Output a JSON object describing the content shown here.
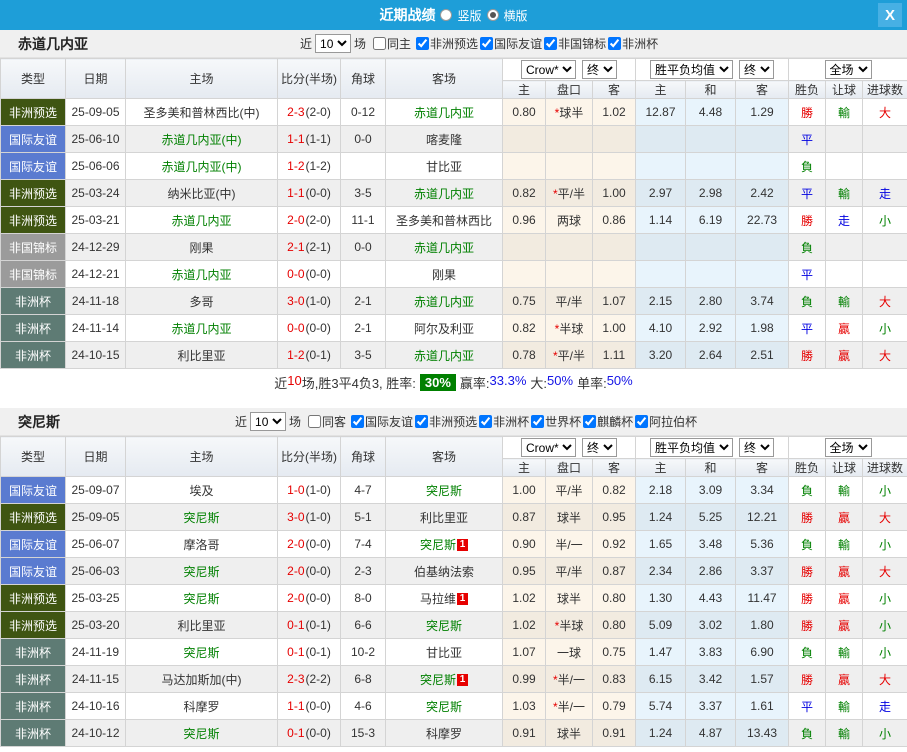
{
  "titlebar": {
    "title": "近期战绩",
    "radio_vertical": "竖版",
    "radio_horizontal": "横版",
    "close_icon": "X"
  },
  "colors": {
    "titlebar_bg": "#1E9ED8",
    "close_btn_bg": "#47B0E4",
    "type_africa_qualifier": "#3F5512",
    "type_intl_friendly": "#5A7BD0",
    "type_african_nations_champ": "#9B9B9B",
    "type_africa_cup": "#5E7B74",
    "self_team_green": "#008000",
    "score_red": "#E60000",
    "win_red": "#E60000",
    "draw_blue": "#0000E0",
    "lose_green": "#008000",
    "summary_badge_green": "#008000"
  },
  "columns": {
    "type": "类型",
    "date": "日期",
    "home": "主场",
    "score": "比分(半场)",
    "corner": "角球",
    "away": "客场",
    "odds_home": "主",
    "odds_handicap": "盘口",
    "odds_away": "客",
    "avg_home": "主",
    "avg_draw": "和",
    "avg_away": "客",
    "result": "胜负",
    "handicap_result": "让球",
    "goals": "进球数"
  },
  "dropdowns": {
    "bookmaker": "Crow*",
    "final1": "终",
    "avg": "胜平负均值",
    "final2": "终",
    "scope": "全场"
  },
  "sections": [
    {
      "team": "赤道几内亚",
      "filter": {
        "near_label": "近",
        "count": "10",
        "games_label": "场",
        "same_label": "同主",
        "leagues": [
          "非洲预选",
          "国际友谊",
          "非国锦标",
          "非洲杯"
        ]
      },
      "rows": [
        {
          "type": "非洲预选",
          "date": "25-09-05",
          "home": "圣多美和普林西比(中)",
          "home_self": false,
          "score": "2-3",
          "half": "(2-0)",
          "corner": "0-12",
          "away": "赤道几内亚",
          "away_self": true,
          "badge": "",
          "odds_home": "0.80",
          "handicap": "*球半",
          "odds_away": "1.02",
          "avg_home": "12.87",
          "avg_draw": "4.48",
          "avg_away": "1.29",
          "result": "勝",
          "handicap_result": "輸",
          "goal_result": "大"
        },
        {
          "type": "国际友谊",
          "date": "25-06-10",
          "home": "赤道几内亚(中)",
          "home_self": true,
          "score": "1-1",
          "half": "(1-1)",
          "corner": "0-0",
          "away": "喀麦隆",
          "away_self": false,
          "badge": "",
          "odds_home": "",
          "handicap": "",
          "odds_away": "",
          "avg_home": "",
          "avg_draw": "",
          "avg_away": "",
          "result": "平",
          "handicap_result": "",
          "goal_result": ""
        },
        {
          "type": "国际友谊",
          "date": "25-06-06",
          "home": "赤道几内亚(中)",
          "home_self": true,
          "score": "1-2",
          "half": "(1-2)",
          "corner": "",
          "away": "甘比亚",
          "away_self": false,
          "badge": "",
          "odds_home": "",
          "handicap": "",
          "odds_away": "",
          "avg_home": "",
          "avg_draw": "",
          "avg_away": "",
          "result": "負",
          "handicap_result": "",
          "goal_result": ""
        },
        {
          "type": "非洲预选",
          "date": "25-03-24",
          "home": "纳米比亚(中)",
          "home_self": false,
          "score": "1-1",
          "half": "(0-0)",
          "corner": "3-5",
          "away": "赤道几内亚",
          "away_self": true,
          "badge": "",
          "odds_home": "0.82",
          "handicap": "*平/半",
          "odds_away": "1.00",
          "avg_home": "2.97",
          "avg_draw": "2.98",
          "avg_away": "2.42",
          "result": "平",
          "handicap_result": "輸",
          "goal_result": "走"
        },
        {
          "type": "非洲预选",
          "date": "25-03-21",
          "home": "赤道几内亚",
          "home_self": true,
          "score": "2-0",
          "half": "(2-0)",
          "corner": "11-1",
          "away": "圣多美和普林西比",
          "away_self": false,
          "badge": "",
          "odds_home": "0.96",
          "handicap": "两球",
          "odds_away": "0.86",
          "avg_home": "1.14",
          "avg_draw": "6.19",
          "avg_away": "22.73",
          "result": "勝",
          "handicap_result": "走",
          "goal_result": "小"
        },
        {
          "type": "非国锦标",
          "date": "24-12-29",
          "home": "刚果",
          "home_self": false,
          "score": "2-1",
          "half": "(2-1)",
          "corner": "0-0",
          "away": "赤道几内亚",
          "away_self": true,
          "badge": "",
          "odds_home": "",
          "handicap": "",
          "odds_away": "",
          "avg_home": "",
          "avg_draw": "",
          "avg_away": "",
          "result": "負",
          "handicap_result": "",
          "goal_result": ""
        },
        {
          "type": "非国锦标",
          "date": "24-12-21",
          "home": "赤道几内亚",
          "home_self": true,
          "score": "0-0",
          "half": "(0-0)",
          "corner": "",
          "away": "刚果",
          "away_self": false,
          "badge": "",
          "odds_home": "",
          "handicap": "",
          "odds_away": "",
          "avg_home": "",
          "avg_draw": "",
          "avg_away": "",
          "result": "平",
          "handicap_result": "",
          "goal_result": ""
        },
        {
          "type": "非洲杯",
          "date": "24-11-18",
          "home": "多哥",
          "home_self": false,
          "score": "3-0",
          "half": "(1-0)",
          "corner": "2-1",
          "away": "赤道几内亚",
          "away_self": true,
          "badge": "",
          "odds_home": "0.75",
          "handicap": "平/半",
          "odds_away": "1.07",
          "avg_home": "2.15",
          "avg_draw": "2.80",
          "avg_away": "3.74",
          "result": "負",
          "handicap_result": "輸",
          "goal_result": "大"
        },
        {
          "type": "非洲杯",
          "date": "24-11-14",
          "home": "赤道几内亚",
          "home_self": true,
          "score": "0-0",
          "half": "(0-0)",
          "corner": "2-1",
          "away": "阿尔及利亚",
          "away_self": false,
          "badge": "",
          "odds_home": "0.82",
          "handicap": "*半球",
          "odds_away": "1.00",
          "avg_home": "4.10",
          "avg_draw": "2.92",
          "avg_away": "1.98",
          "result": "平",
          "handicap_result": "贏",
          "goal_result": "小"
        },
        {
          "type": "非洲杯",
          "date": "24-10-15",
          "home": "利比里亚",
          "home_self": false,
          "score": "1-2",
          "half": "(0-1)",
          "corner": "3-5",
          "away": "赤道几内亚",
          "away_self": true,
          "badge": "",
          "odds_home": "0.78",
          "handicap": "*平/半",
          "odds_away": "1.11",
          "avg_home": "3.20",
          "avg_draw": "2.64",
          "avg_away": "2.51",
          "result": "勝",
          "handicap_result": "贏",
          "goal_result": "大"
        }
      ],
      "summary": {
        "prefix": "近",
        "count": "10",
        "middle": "场,胜3平4负3, 胜率:",
        "win_rate": "30%",
        "stats": [
          {
            "label": "赢率:",
            "value": "33.3%"
          },
          {
            "label": "大:",
            "value": "50%"
          },
          {
            "label": "单率:",
            "value": "50%"
          }
        ]
      }
    },
    {
      "team": "突尼斯",
      "filter": {
        "near_label": "近",
        "count": "10",
        "games_label": "场",
        "same_label": "同客",
        "leagues": [
          "国际友谊",
          "非洲预选",
          "非洲杯",
          "世界杯",
          "麒麟杯",
          "阿拉伯杯"
        ]
      },
      "rows": [
        {
          "type": "国际友谊",
          "date": "25-09-07",
          "home": "埃及",
          "home_self": false,
          "score": "1-0",
          "half": "(1-0)",
          "corner": "4-7",
          "away": "突尼斯",
          "away_self": true,
          "badge": "",
          "odds_home": "1.00",
          "handicap": "平/半",
          "odds_away": "0.82",
          "avg_home": "2.18",
          "avg_draw": "3.09",
          "avg_away": "3.34",
          "result": "負",
          "handicap_result": "輸",
          "goal_result": "小"
        },
        {
          "type": "非洲预选",
          "date": "25-09-05",
          "home": "突尼斯",
          "home_self": true,
          "score": "3-0",
          "half": "(1-0)",
          "corner": "5-1",
          "away": "利比里亚",
          "away_self": false,
          "badge": "",
          "odds_home": "0.87",
          "handicap": "球半",
          "odds_away": "0.95",
          "avg_home": "1.24",
          "avg_draw": "5.25",
          "avg_away": "12.21",
          "result": "勝",
          "handicap_result": "贏",
          "goal_result": "大"
        },
        {
          "type": "国际友谊",
          "date": "25-06-07",
          "home": "摩洛哥",
          "home_self": false,
          "score": "2-0",
          "half": "(0-0)",
          "corner": "7-4",
          "away": "突尼斯",
          "away_self": true,
          "badge": "1",
          "odds_home": "0.90",
          "handicap": "半/一",
          "odds_away": "0.92",
          "avg_home": "1.65",
          "avg_draw": "3.48",
          "avg_away": "5.36",
          "result": "負",
          "handicap_result": "輸",
          "goal_result": "小"
        },
        {
          "type": "国际友谊",
          "date": "25-06-03",
          "home": "突尼斯",
          "home_self": true,
          "score": "2-0",
          "half": "(0-0)",
          "corner": "2-3",
          "away": "伯基纳法索",
          "away_self": false,
          "badge": "",
          "odds_home": "0.95",
          "handicap": "平/半",
          "odds_away": "0.87",
          "avg_home": "2.34",
          "avg_draw": "2.86",
          "avg_away": "3.37",
          "result": "勝",
          "handicap_result": "贏",
          "goal_result": "大"
        },
        {
          "type": "非洲预选",
          "date": "25-03-25",
          "home": "突尼斯",
          "home_self": true,
          "score": "2-0",
          "half": "(0-0)",
          "corner": "8-0",
          "away": "马拉维",
          "away_self": false,
          "badge": "1",
          "odds_home": "1.02",
          "handicap": "球半",
          "odds_away": "0.80",
          "avg_home": "1.30",
          "avg_draw": "4.43",
          "avg_away": "11.47",
          "result": "勝",
          "handicap_result": "贏",
          "goal_result": "小"
        },
        {
          "type": "非洲预选",
          "date": "25-03-20",
          "home": "利比里亚",
          "home_self": false,
          "score": "0-1",
          "half": "(0-1)",
          "corner": "6-6",
          "away": "突尼斯",
          "away_self": true,
          "badge": "",
          "odds_home": "1.02",
          "handicap": "*半球",
          "odds_away": "0.80",
          "avg_home": "5.09",
          "avg_draw": "3.02",
          "avg_away": "1.80",
          "result": "勝",
          "handicap_result": "贏",
          "goal_result": "小"
        },
        {
          "type": "非洲杯",
          "date": "24-11-19",
          "home": "突尼斯",
          "home_self": true,
          "score": "0-1",
          "half": "(0-1)",
          "corner": "10-2",
          "away": "甘比亚",
          "away_self": false,
          "badge": "",
          "odds_home": "1.07",
          "handicap": "一球",
          "odds_away": "0.75",
          "avg_home": "1.47",
          "avg_draw": "3.83",
          "avg_away": "6.90",
          "result": "負",
          "handicap_result": "輸",
          "goal_result": "小"
        },
        {
          "type": "非洲杯",
          "date": "24-11-15",
          "home": "马达加斯加(中)",
          "home_self": false,
          "score": "2-3",
          "half": "(2-2)",
          "corner": "6-8",
          "away": "突尼斯",
          "away_self": true,
          "badge": "1",
          "odds_home": "0.99",
          "handicap": "*半/一",
          "odds_away": "0.83",
          "avg_home": "6.15",
          "avg_draw": "3.42",
          "avg_away": "1.57",
          "result": "勝",
          "handicap_result": "贏",
          "goal_result": "大"
        },
        {
          "type": "非洲杯",
          "date": "24-10-16",
          "home": "科摩罗",
          "home_self": false,
          "score": "1-1",
          "half": "(0-0)",
          "corner": "4-6",
          "away": "突尼斯",
          "away_self": true,
          "badge": "",
          "odds_home": "1.03",
          "handicap": "*半/一",
          "odds_away": "0.79",
          "avg_home": "5.74",
          "avg_draw": "3.37",
          "avg_away": "1.61",
          "result": "平",
          "handicap_result": "輸",
          "goal_result": "走"
        },
        {
          "type": "非洲杯",
          "date": "24-10-12",
          "home": "突尼斯",
          "home_self": true,
          "score": "0-1",
          "half": "(0-0)",
          "corner": "15-3",
          "away": "科摩罗",
          "away_self": false,
          "badge": "",
          "odds_home": "0.91",
          "handicap": "球半",
          "odds_away": "0.91",
          "avg_home": "1.24",
          "avg_draw": "4.87",
          "avg_away": "13.43",
          "result": "負",
          "handicap_result": "輸",
          "goal_result": "小"
        }
      ]
    }
  ]
}
